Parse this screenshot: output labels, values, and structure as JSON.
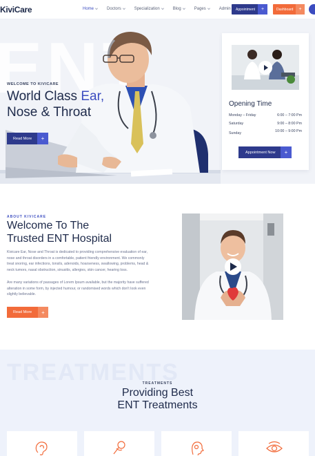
{
  "header": {
    "logo": "KiviCare",
    "nav": [
      {
        "label": "Home",
        "dropdown": true,
        "active": true
      },
      {
        "label": "Doctors",
        "dropdown": true
      },
      {
        "label": "Specialization",
        "dropdown": true
      },
      {
        "label": "Blog",
        "dropdown": true
      },
      {
        "label": "Pages",
        "dropdown": true
      },
      {
        "label": "Admin",
        "dropdown": false
      }
    ],
    "appointment_btn": "Appointment",
    "dashboard_btn": "Dashboard",
    "plus": "+"
  },
  "hero": {
    "watermark": "ENT",
    "welcome": "WELCOME TO KIVICARE",
    "title_part1": "World Class ",
    "title_accent": "Ear,",
    "title_line2": "Nose & Throat",
    "read_more": "Read More",
    "plus": "+"
  },
  "opening": {
    "title": "Opening Time",
    "rows": [
      {
        "day": "Monday – Friday",
        "time": "6:00 – 7:00 Pm"
      },
      {
        "day": "Saturday",
        "time": "9:00 – 8:00 Pm"
      },
      {
        "day": "Sunday",
        "time": "10:00 – 9:00 Pm"
      }
    ],
    "appointment_btn": "Appointment Now",
    "plus": "+"
  },
  "about": {
    "kicker": "ABOUT KIVICARE",
    "title_line1": "Welcome To The",
    "title_line2": "Trusted ENT Hospital",
    "para1_lines": [
      "Kivicare Ear, Nose and Throat is dedicated to providing comprehensive evaluation of ear,",
      "nose and throat disorders in a comfortable, patient friendly environment. We commonly",
      "treat snoring, ear infections, tonsils, adenoids, hoarseness, swallowing, problems, head &",
      "neck tumors, nasal obstruction, sinusitis, allergies, skin cancer, hearing loss."
    ],
    "para2_lines": [
      "Are many variations of passages of Lorem Ipsum available, but the majority have suffered",
      "alteration in some form, by injected humour, or randomised words which don't look even",
      "slightly believable."
    ],
    "read_more": "Read More",
    "plus": "+"
  },
  "treatments": {
    "watermark": "TREATMENTS",
    "kicker": "TREATMENTS",
    "title_line1": "Providing Best",
    "title_line2": "ENT Treatments",
    "icons": [
      "ear-icon",
      "throat-icon",
      "head-profile-icon",
      "eye-icon"
    ]
  },
  "colors": {
    "navy": "#2e3a8c",
    "indigo": "#3b4cc0",
    "orange": "#f26b3a",
    "dark_text": "#1e2a4a"
  }
}
